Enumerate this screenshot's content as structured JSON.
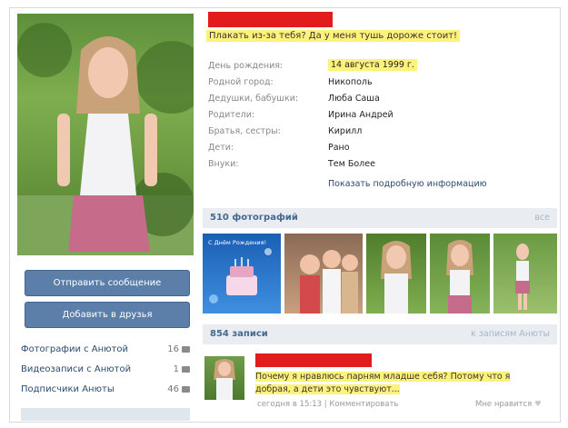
{
  "sidebar": {
    "send_message": "Отправить сообщение",
    "add_friend": "Добавить в друзья",
    "items": [
      {
        "label": "Фотографии с Анютой",
        "count": "16"
      },
      {
        "label": "Видеозаписи с Анютой",
        "count": "1"
      },
      {
        "label": "Подписчики Анюты",
        "count": "46"
      }
    ]
  },
  "profile": {
    "status": "Плакать из-за тебя? Да у меня тушь дороже стоит!",
    "info": [
      {
        "label": "День рождения:",
        "value": "14 августа 1999 г."
      },
      {
        "label": "Родной город:",
        "value": "Никополь"
      },
      {
        "label": "Дедушки, бабушки:",
        "value": "Люба Саша"
      },
      {
        "label": "Родители:",
        "value": "Ирина Андрей"
      },
      {
        "label": "Братья, сестры:",
        "value": "Кирилл"
      },
      {
        "label": "Дети:",
        "value": "Рано"
      },
      {
        "label": "Внуки:",
        "value": "Тем Более"
      }
    ],
    "more_info": "Показать подробную информацию"
  },
  "photos": {
    "title": "510 фотографий",
    "all_link": "все",
    "first_caption": "С Днём Рождения!"
  },
  "wall": {
    "title": "854 записи",
    "link": "к записям Анюты",
    "post_text": "Почему я нравлюсь парням младше себя? Потому что я добрая, а дети это чувствуют...",
    "post_time": "сегодня в 15:13",
    "comment": "Комментировать",
    "like": "Мне нравится"
  },
  "colors": {
    "accent": "#45688e",
    "highlight": "#fff27a",
    "redact": "#e21c1c"
  }
}
